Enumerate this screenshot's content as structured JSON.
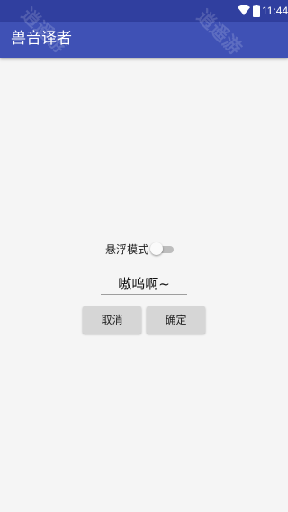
{
  "status_bar": {
    "time": "11:44",
    "icons": [
      "wifi-icon",
      "battery-icon"
    ]
  },
  "app_bar": {
    "title": "兽音译者",
    "background": "#3f51b5"
  },
  "watermark": {
    "text_1": "逍遥游",
    "text_2": "逍遥游"
  },
  "floating_mode": {
    "label": "悬浮模式",
    "enabled": false
  },
  "input": {
    "value": "嗷呜啊~"
  },
  "buttons": {
    "cancel": "取消",
    "confirm": "确定"
  }
}
